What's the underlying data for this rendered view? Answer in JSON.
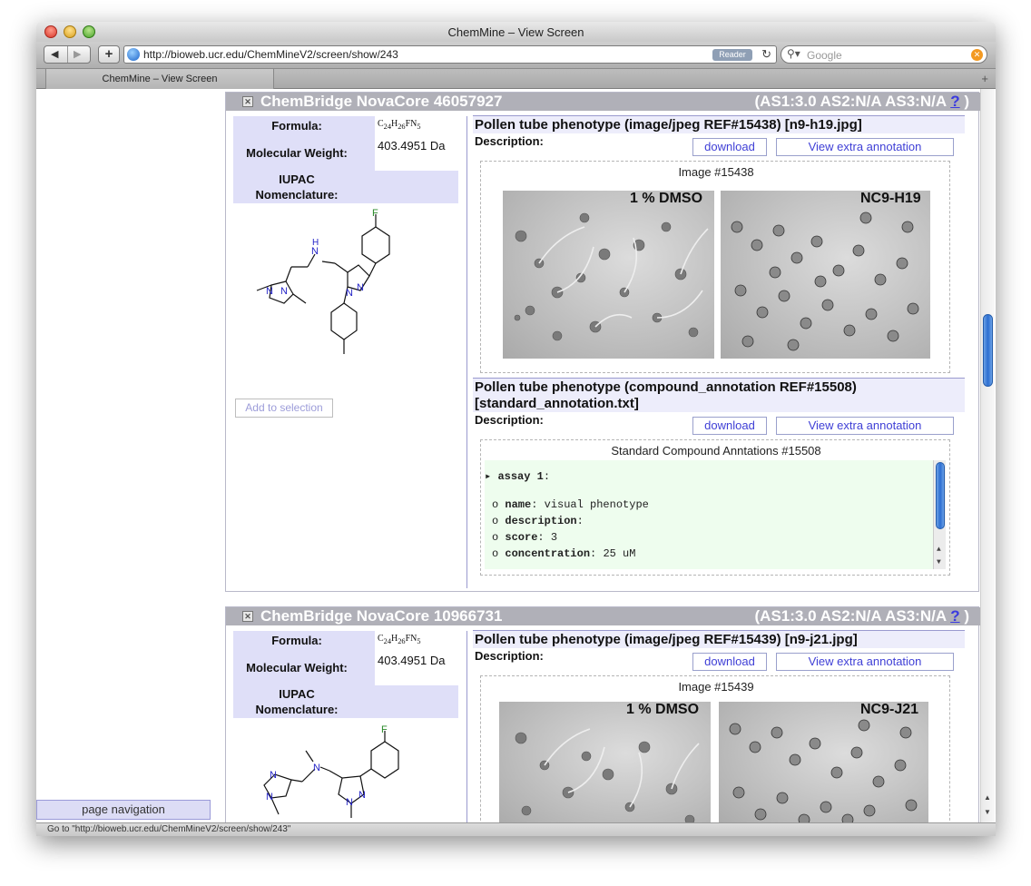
{
  "browser": {
    "window_title": "ChemMine – View Screen",
    "url": "http://bioweb.ucr.edu/ChemMineV2/screen/show/243",
    "reader_label": "Reader",
    "search_placeholder": "Google",
    "tab_title": "ChemMine – View Screen",
    "status_text": "Go to \"http://bioweb.ucr.edu/ChemMineV2/screen/show/243\""
  },
  "sidebar": {
    "page_navigation_label": "page navigation"
  },
  "compounds": [
    {
      "name": "ChemBridge NovaCore 46057927",
      "as_scores": "(AS1:3.0 AS2:N/A AS3:N/A",
      "help": "?",
      "close_paren": ")",
      "props": {
        "formula_label": "Formula:",
        "formula_value": "C24H26FN5",
        "mw_label": "Molecular Weight:",
        "mw_value": "403.4951 Da",
        "iupac_label": "IUPAC Nomenclature:"
      },
      "add_selection_label": "Add to selection",
      "datasets": [
        {
          "title": "Pollen tube phenotype (image/jpeg REF#15438) [n9-h19.jpg]",
          "description_label": "Description:",
          "download_label": "download",
          "annotation_label": "View extra annotation",
          "caption": "Image #15438",
          "image_labels": [
            "1 % DMSO",
            "NC9-H19"
          ]
        },
        {
          "title": "Pollen tube phenotype (compound_annotation REF#15508) [standard_annotation.txt]",
          "description_label": "Description:",
          "download_label": "download",
          "annotation_label": "View extra annotation",
          "caption": "Standard Compound Anntations #15508",
          "annotation": {
            "assay_key": "assay 1",
            "name_key": "name",
            "name_value": "visual phenotype",
            "description_key": "description",
            "score_key": "score",
            "score_value": "3",
            "concentration_key": "concentration",
            "concentration_value": "25 uM"
          }
        }
      ]
    },
    {
      "name": "ChemBridge NovaCore 10966731",
      "as_scores": "(AS1:3.0 AS2:N/A AS3:N/A",
      "help": "?",
      "close_paren": ")",
      "props": {
        "formula_label": "Formula:",
        "formula_value": "C24H26FN5",
        "mw_label": "Molecular Weight:",
        "mw_value": "403.4951 Da",
        "iupac_label": "IUPAC Nomenclature:"
      },
      "datasets": [
        {
          "title": "Pollen tube phenotype (image/jpeg REF#15439) [n9-j21.jpg]",
          "description_label": "Description:",
          "download_label": "download",
          "annotation_label": "View extra annotation",
          "caption": "Image #15439",
          "image_labels": [
            "1 % DMSO",
            "NC9-J21"
          ]
        }
      ]
    }
  ],
  "colors": {
    "header_bar": "#b0b0b8",
    "prop_bg": "#dfdff8",
    "link_blue": "#3f3fd6",
    "annotation_bg": "#eefdee"
  }
}
